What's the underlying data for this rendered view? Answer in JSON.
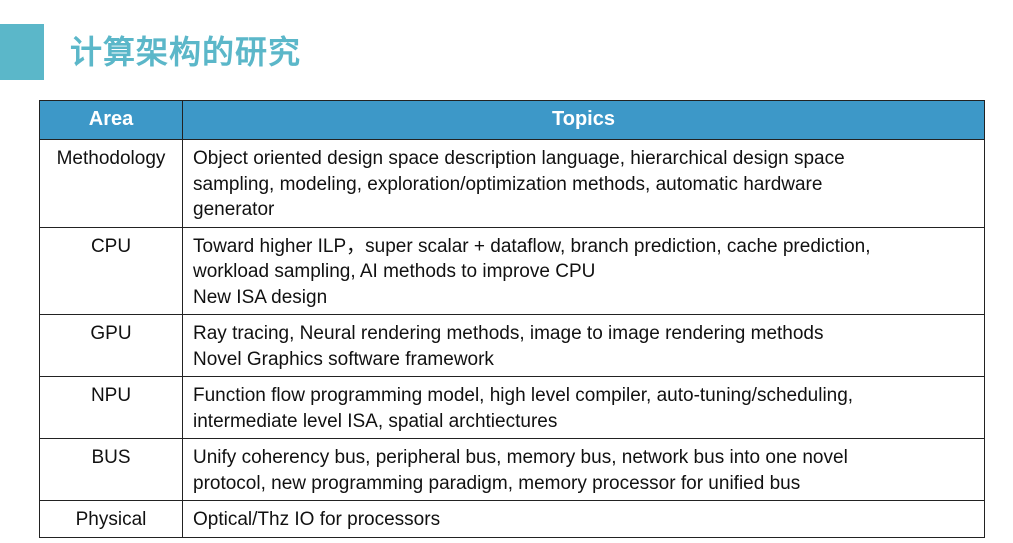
{
  "slide": {
    "title": "计算架构的研究"
  },
  "table": {
    "headers": {
      "area": "Area",
      "topics": "Topics"
    },
    "rows": [
      {
        "area": "Methodology",
        "lines": [
          "Object oriented design space description language, hierarchical design space",
          "sampling, modeling, exploration/optimization methods, automatic hardware",
          "generator"
        ]
      },
      {
        "area": "CPU",
        "lines": [
          "Toward higher ILP，super scalar + dataflow, branch prediction, cache prediction,",
          "workload sampling, AI methods to improve CPU",
          "New ISA design"
        ]
      },
      {
        "area": "GPU",
        "lines": [
          "Ray tracing, Neural rendering methods, image to image rendering methods",
          "Novel Graphics software framework"
        ]
      },
      {
        "area": "NPU",
        "lines": [
          "Function flow programming model, high level compiler, auto-tuning/scheduling,",
          "intermediate level ISA, spatial archtiectures"
        ]
      },
      {
        "area": "BUS",
        "lines": [
          "Unify coherency bus, peripheral bus, memory bus, network bus into one novel",
          "protocol, new programming paradigm, memory processor for unified bus"
        ]
      },
      {
        "area": "Physical",
        "lines": [
          "Optical/Thz IO for processors"
        ]
      }
    ]
  },
  "colors": {
    "accent": "#5bb7c9",
    "header_bg": "#3d98c8",
    "header_text": "#ffffff",
    "border": "#222222"
  }
}
